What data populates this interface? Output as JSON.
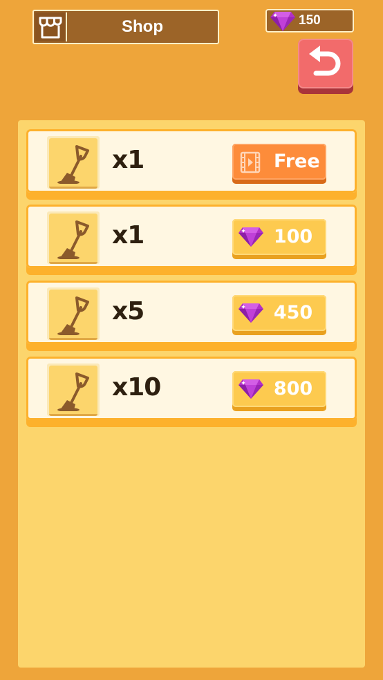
{
  "header": {
    "title": "Shop",
    "icon": "shop-icon"
  },
  "currency": {
    "icon": "gem-icon",
    "amount": "150"
  },
  "back_button": {
    "icon": "undo-arrow-icon"
  },
  "shop_items": [
    {
      "icon": "shovel-icon",
      "quantity": "x1",
      "price_type": "video",
      "price_icon": "video-icon",
      "price_label": "Free"
    },
    {
      "icon": "shovel-icon",
      "quantity": "x1",
      "price_type": "gem",
      "price_icon": "gem-icon",
      "price_label": "100"
    },
    {
      "icon": "shovel-icon",
      "quantity": "x5",
      "price_type": "gem",
      "price_icon": "gem-icon",
      "price_label": "450"
    },
    {
      "icon": "shovel-icon",
      "quantity": "x10",
      "price_type": "gem",
      "price_icon": "gem-icon",
      "price_label": "800"
    }
  ],
  "colors": {
    "background": "#eea53a",
    "panel": "#fcd56c",
    "free_button": "#fd8c3a",
    "gem_button": "#fdca4f",
    "back_button": "#f26b6b",
    "gem": "#b230c8"
  }
}
